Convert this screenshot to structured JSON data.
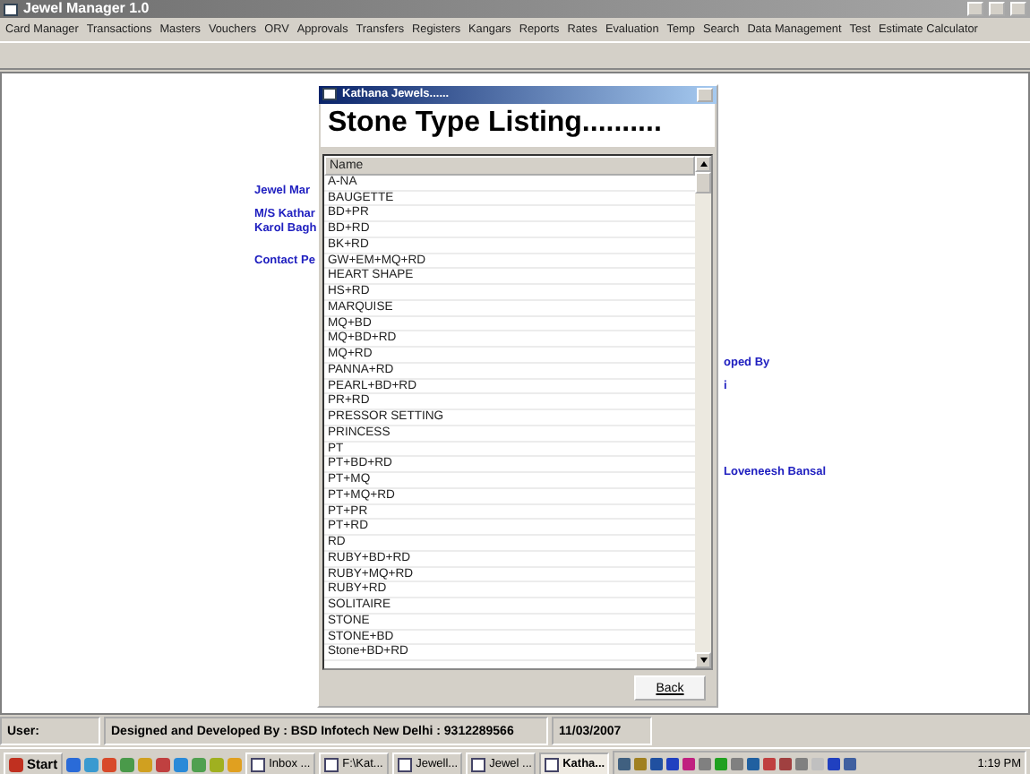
{
  "window": {
    "title": "Jewel Manager 1.0"
  },
  "menu": [
    "Card Manager",
    "Transactions",
    "Masters",
    "Vouchers",
    "ORV",
    "Approvals",
    "Transfers",
    "Registers",
    "Kangars",
    "Reports",
    "Rates",
    "Evaluation",
    "Temp",
    "Search",
    "Data Management",
    "Test",
    "Estimate Calculator"
  ],
  "background_left": [
    "Jewel Mar",
    "M/S Kathar",
    "Karol Bagh",
    "Contact Pe"
  ],
  "background_right": [
    "oped By",
    "i",
    "Loveneesh Bansal"
  ],
  "dialog": {
    "title": "Kathana Jewels......",
    "heading": "Stone Type Listing..........",
    "column": "Name",
    "rows": [
      "A-NA",
      "BAUGETTE",
      "BD+PR",
      "BD+RD",
      "BK+RD",
      "GW+EM+MQ+RD",
      "HEART SHAPE",
      "HS+RD",
      "MARQUISE",
      "MQ+BD",
      "MQ+BD+RD",
      "MQ+RD",
      "PANNA+RD",
      "PEARL+BD+RD",
      "PR+RD",
      "PRESSOR SETTING",
      "PRINCESS",
      "PT",
      "PT+BD+RD",
      "PT+MQ",
      "PT+MQ+RD",
      "PT+PR",
      "PT+RD",
      "RD",
      "RUBY+BD+RD",
      "RUBY+MQ+RD",
      "RUBY+RD",
      "SOLITAIRE",
      "STONE",
      "STONE+BD",
      "Stone+BD+RD"
    ],
    "back_button": "Back"
  },
  "status_bar": [
    "User:",
    "Designed and Developed By : BSD Infotech New Delhi : 9312289566",
    "11/03/2007"
  ],
  "taskbar": {
    "start": "Start",
    "tasks": [
      {
        "label": "Inbox ...",
        "selected": false
      },
      {
        "label": "F:\\Kat...",
        "selected": false
      },
      {
        "label": "Jewell...",
        "selected": false
      },
      {
        "label": "Jewel ...",
        "selected": false
      },
      {
        "label": "Katha...",
        "selected": true
      }
    ],
    "clock": "1:19 PM"
  }
}
